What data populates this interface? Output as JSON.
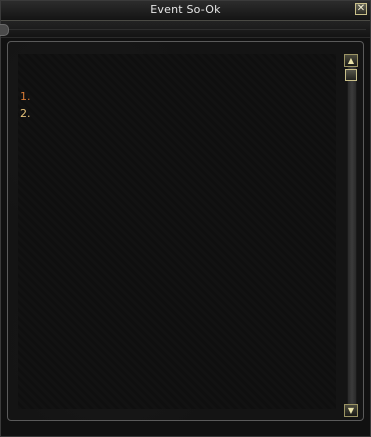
{
  "window": {
    "title": "Event So-Ok",
    "close_glyph": "✕"
  },
  "list": {
    "items": [
      "1.",
      "2."
    ]
  },
  "scrollbar": {
    "up_glyph": "▲",
    "down_glyph": "▼"
  },
  "colors": {
    "item_1": "#d77a36",
    "item_2": "#e6c27a",
    "title_text": "#e6e6e6",
    "accent_gold": "#c9c08a"
  },
  "icons": {
    "close": "close-icon",
    "scroll_up": "arrow-up-icon",
    "scroll_down": "arrow-down-icon"
  }
}
